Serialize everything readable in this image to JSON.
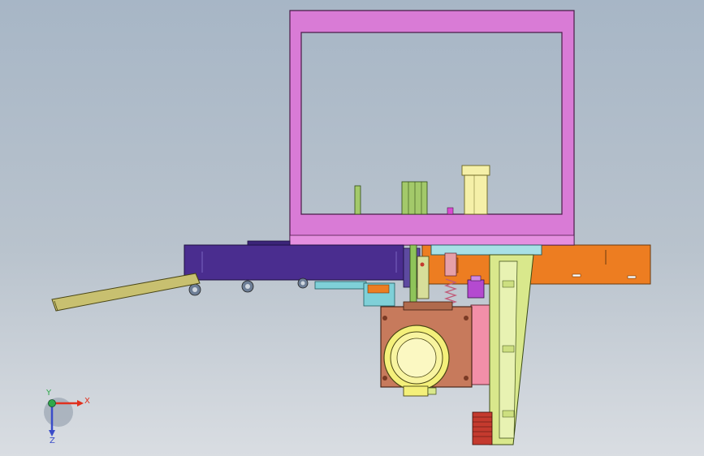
{
  "viewport": {
    "background_top": "#a7b6c6",
    "background_bottom": "#d9dde2"
  },
  "colors": {
    "frame": "#d97bd6",
    "base_plate": "#ed7d21",
    "conveyor_rail": "#4a2d8f",
    "support_column": "#d9e88c",
    "gearbox_housing": "#c77a5c",
    "motor_face": "#f4f07a",
    "pink_plate": "#f28fa8",
    "cylinder": "#f5f0a8",
    "rod": "#a3c96a",
    "teal_bracket": "#7fd0d8",
    "spring": "#c05a78",
    "red_rack": "#c43a2e",
    "chute": "#c8c070"
  },
  "triad": {
    "x_label": "X",
    "y_label": "Y",
    "z_label": "Z",
    "x_color": "#e0301e",
    "y_color": "#2ea84a",
    "z_color": "#3a4cc9"
  }
}
